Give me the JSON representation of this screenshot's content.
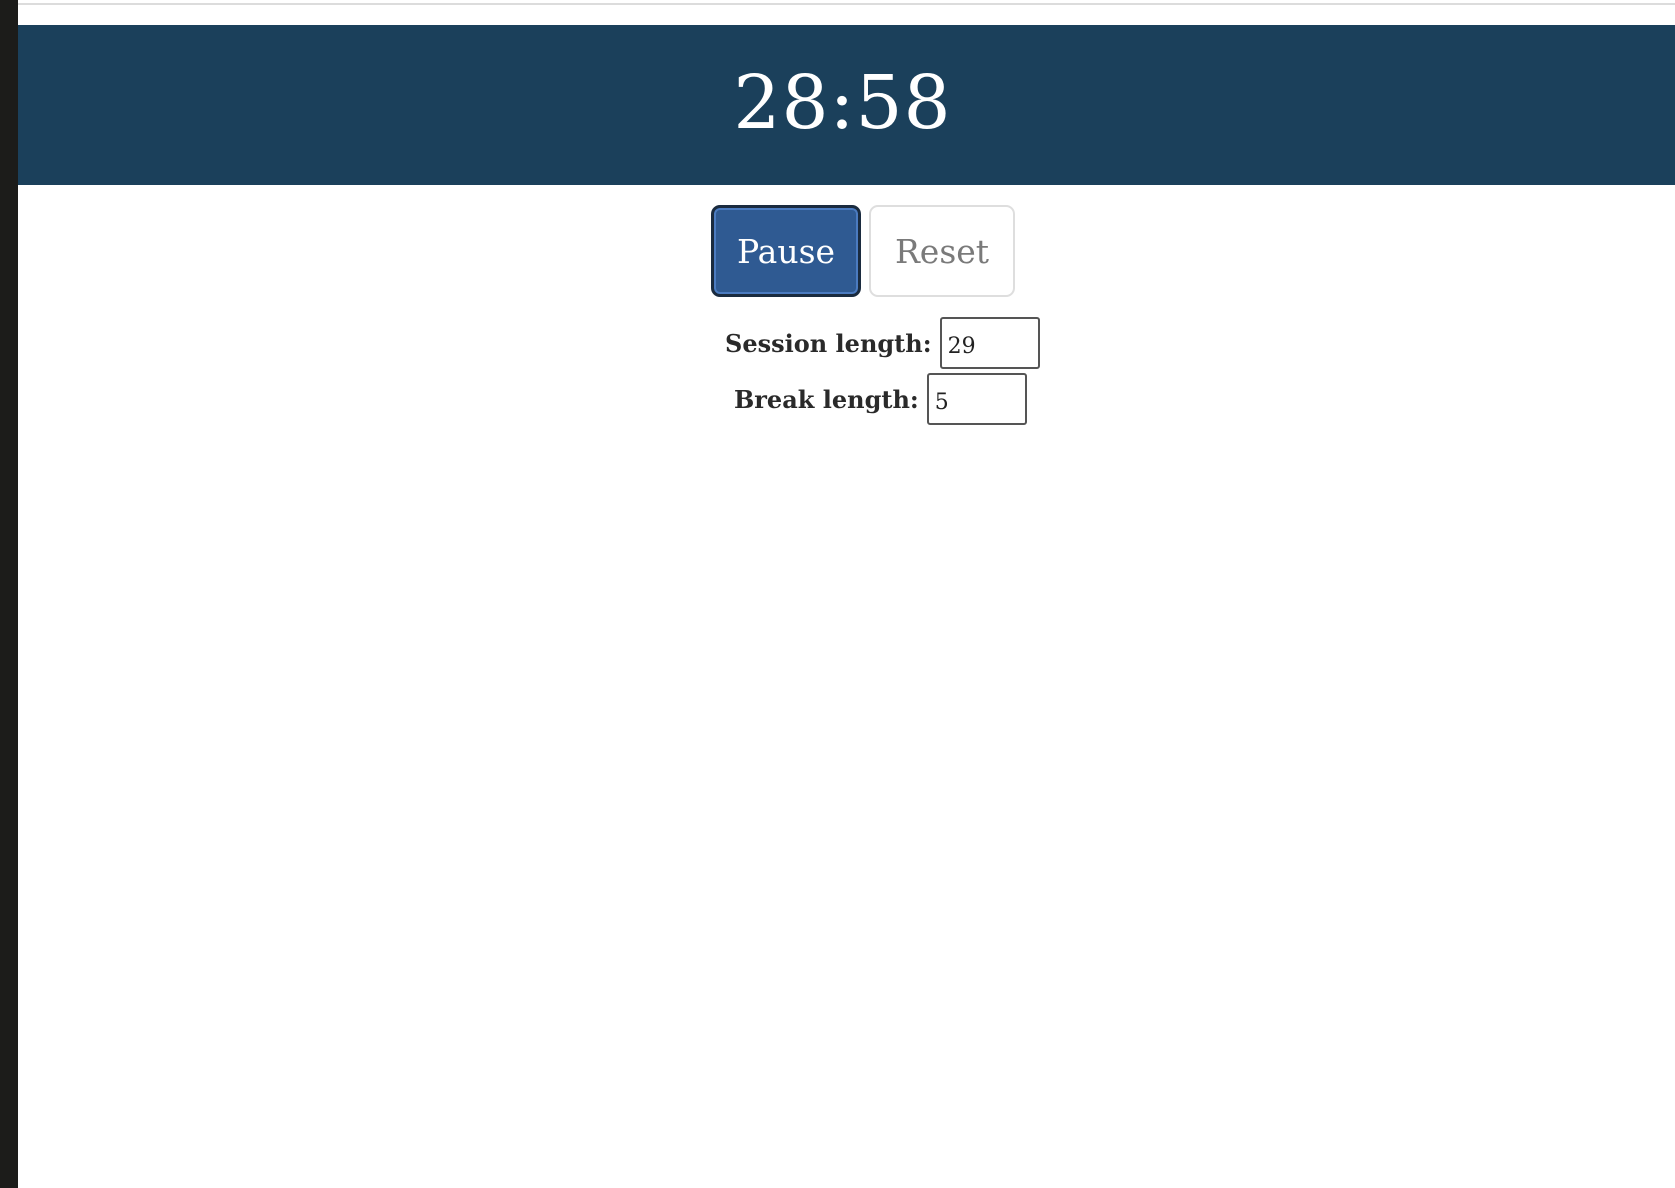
{
  "timer": {
    "display": "28:58"
  },
  "controls": {
    "pause_label": "Pause",
    "reset_label": "Reset"
  },
  "settings": {
    "session_label": "Session length:",
    "session_value": "29",
    "break_label": "Break length:",
    "break_value": "5"
  },
  "colors": {
    "header_bg": "#1b405b",
    "pause_bg": "#2f5a92",
    "reset_text": "#7a7a7a"
  }
}
